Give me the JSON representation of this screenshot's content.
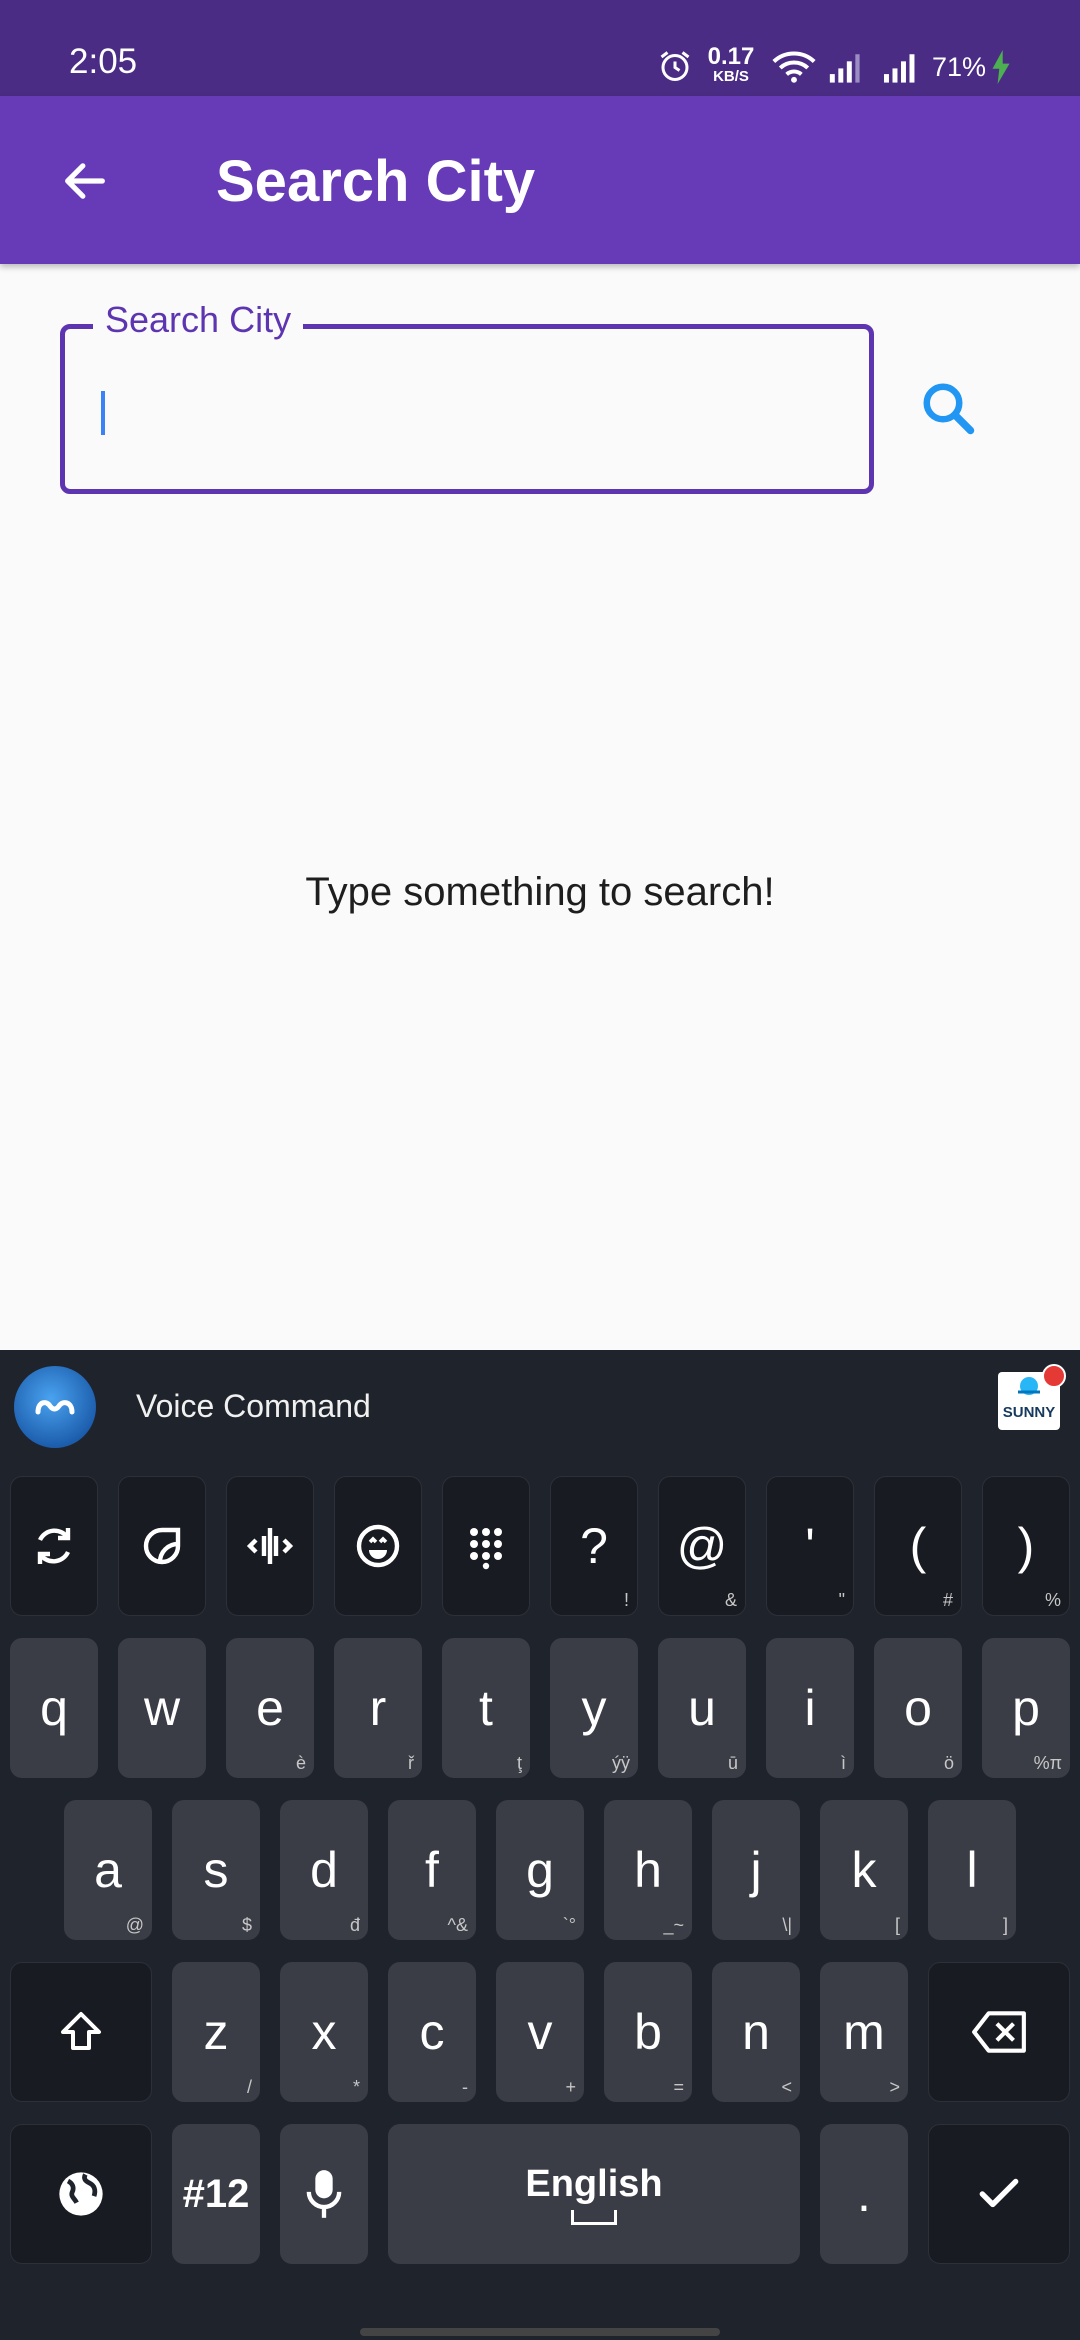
{
  "status_bar": {
    "time": "2:05",
    "net_speed_value": "0.17",
    "net_speed_unit": "KB/S",
    "battery": "71%",
    "icons": [
      "alarm-icon",
      "wifi-icon",
      "signal-icon",
      "signal-icon",
      "charging-icon"
    ]
  },
  "app_bar": {
    "title": "Search City",
    "back_icon": "arrow-left-icon"
  },
  "search": {
    "label": "Search City",
    "value": "",
    "placeholder": "",
    "button_icon": "search-icon"
  },
  "empty_message": "Type something to search!",
  "keyboard": {
    "voice_label": "Voice Command",
    "badge_text": "SUNNY",
    "toolbar": [
      {
        "icon": "refresh-icon"
      },
      {
        "icon": "sticker-icon"
      },
      {
        "icon": "cursor-move-icon"
      },
      {
        "icon": "emoji-icon"
      },
      {
        "icon": "numpad-icon"
      },
      {
        "main": "?",
        "sub": "!"
      },
      {
        "main": "@",
        "sub": "&"
      },
      {
        "main": "'",
        "sub": "\""
      },
      {
        "main": "(",
        "sub": "#"
      },
      {
        "main": ")",
        "sub": "%"
      }
    ],
    "row1": [
      {
        "main": "q",
        "sub": ""
      },
      {
        "main": "w",
        "sub": ""
      },
      {
        "main": "e",
        "sub": "è"
      },
      {
        "main": "r",
        "sub": "ř"
      },
      {
        "main": "t",
        "sub": "ţ"
      },
      {
        "main": "y",
        "sub": "ýÿ"
      },
      {
        "main": "u",
        "sub": "ū"
      },
      {
        "main": "i",
        "sub": "ì"
      },
      {
        "main": "o",
        "sub": "ö"
      },
      {
        "main": "p",
        "sub": "%π"
      }
    ],
    "row2": [
      {
        "main": "a",
        "sub": "@"
      },
      {
        "main": "s",
        "sub": "$"
      },
      {
        "main": "d",
        "sub": "đ"
      },
      {
        "main": "f",
        "sub": "^&"
      },
      {
        "main": "g",
        "sub": "`°"
      },
      {
        "main": "h",
        "sub": "_~"
      },
      {
        "main": "j",
        "sub": "\\|"
      },
      {
        "main": "k",
        "sub": "["
      },
      {
        "main": "l",
        "sub": "]"
      }
    ],
    "row3": [
      {
        "main": "z",
        "sub": "/"
      },
      {
        "main": "x",
        "sub": "*"
      },
      {
        "main": "c",
        "sub": "-"
      },
      {
        "main": "v",
        "sub": "+"
      },
      {
        "main": "b",
        "sub": "="
      },
      {
        "main": "n",
        "sub": "<"
      },
      {
        "main": "m",
        "sub": ">"
      }
    ],
    "symbols_label": "#12",
    "space_label": "English",
    "period": "."
  },
  "colors": {
    "status_bar": "#4b2c85",
    "app_bar": "#673ab7",
    "accent": "#5e35b1",
    "search_icon": "#2196f3",
    "keyboard_bg": "#1f232c",
    "key_bg": "#3a3d46"
  }
}
